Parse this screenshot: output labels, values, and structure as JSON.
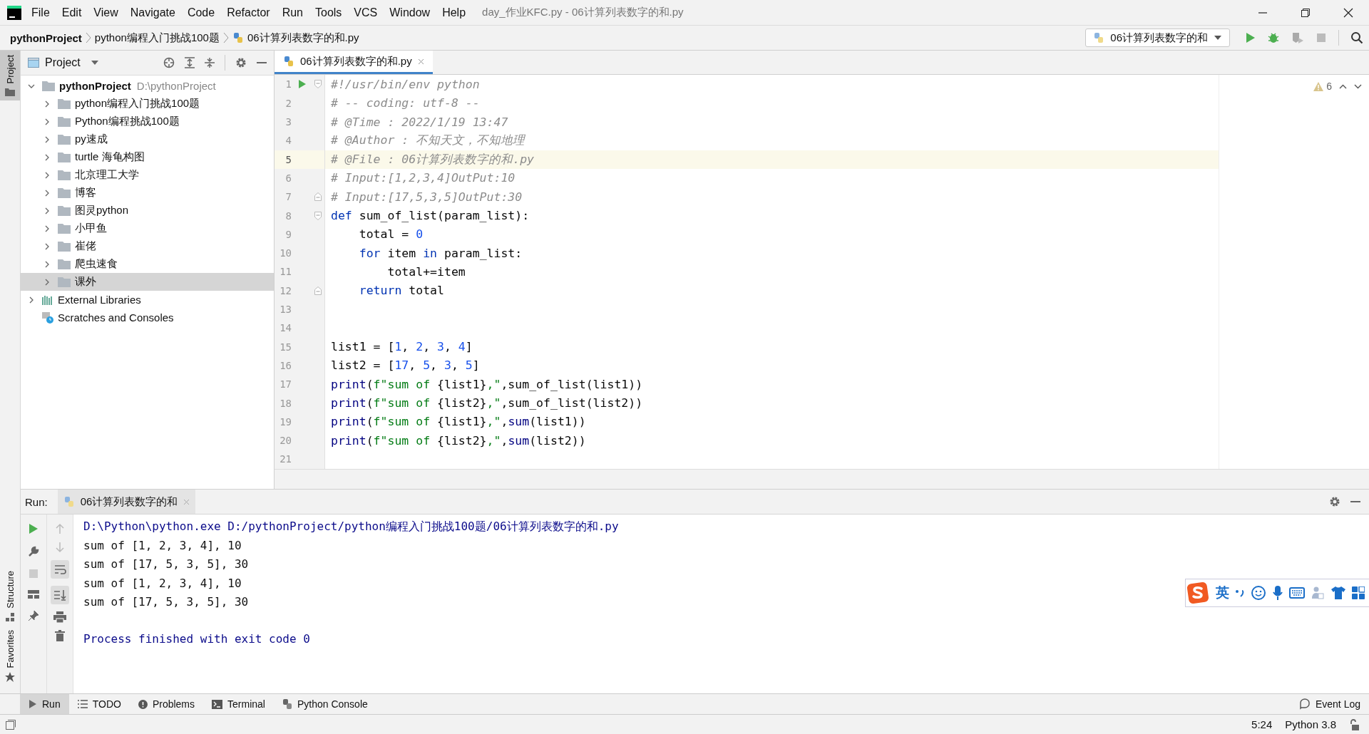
{
  "menu": [
    "File",
    "Edit",
    "View",
    "Navigate",
    "Code",
    "Refactor",
    "Run",
    "Tools",
    "VCS",
    "Window",
    "Help"
  ],
  "window": {
    "title": "day_作业KFC.py - 06计算列表数字的和.py"
  },
  "breadcrumbs": [
    "pythonProject",
    "python编程入门挑战100题",
    "06计算列表数字的和.py"
  ],
  "run_config": "06计算列表数字的和",
  "side_stripe": {
    "top": [
      {
        "label": "Project",
        "selected": true
      }
    ],
    "bottom": [
      {
        "label": "Structure",
        "selected": false
      },
      {
        "label": "Favorites",
        "selected": false
      }
    ]
  },
  "project_panel": {
    "title": "Project"
  },
  "tree": [
    {
      "label": "pythonProject",
      "path": "D:\\pythonProject",
      "kind": "project",
      "expanded": true,
      "selected": false,
      "children": [
        {
          "label": "python编程入门挑战100题",
          "kind": "folder",
          "expanded": false,
          "selected": false
        },
        {
          "label": "Python编程挑战100题",
          "kind": "folder",
          "expanded": false,
          "selected": false
        },
        {
          "label": "py速成",
          "kind": "folder",
          "expanded": false,
          "selected": false
        },
        {
          "label": "turtle 海龟构图",
          "kind": "folder",
          "expanded": false,
          "selected": false
        },
        {
          "label": "北京理工大学",
          "kind": "folder",
          "expanded": false,
          "selected": false
        },
        {
          "label": "博客",
          "kind": "folder",
          "expanded": false,
          "selected": false
        },
        {
          "label": "图灵python",
          "kind": "folder",
          "expanded": false,
          "selected": false
        },
        {
          "label": "小甲鱼",
          "kind": "folder",
          "expanded": false,
          "selected": false
        },
        {
          "label": "崔佬",
          "kind": "folder",
          "expanded": false,
          "selected": false
        },
        {
          "label": "爬虫速食",
          "kind": "folder",
          "expanded": false,
          "selected": false
        },
        {
          "label": "课外",
          "kind": "folder",
          "expanded": false,
          "selected": true
        }
      ]
    },
    {
      "label": "External Libraries",
      "kind": "library",
      "expanded": false,
      "selected": false
    },
    {
      "label": "Scratches and Consoles",
      "kind": "scratches",
      "selected": false
    }
  ],
  "editor_tabs": [
    {
      "label": "06计算列表数字的和.py",
      "selected": true
    }
  ],
  "warnings": "6",
  "code": [
    {
      "n": "1",
      "tokens": [
        {
          "text": "#!/usr/bin/env python",
          "kind": "comment"
        }
      ],
      "run": true,
      "fold_start": true
    },
    {
      "n": "2",
      "tokens": [
        {
          "text": "# -- coding: utf-8 --",
          "kind": "comment"
        }
      ]
    },
    {
      "n": "3",
      "tokens": [
        {
          "text": "# @Time : 2022/1/19 13:47",
          "kind": "comment"
        }
      ]
    },
    {
      "n": "4",
      "tokens": [
        {
          "text": "# @Author : 不知天文，不知地理",
          "kind": "comment"
        }
      ]
    },
    {
      "n": "5",
      "tokens": [
        {
          "text": "# @File : 06计算列表数字的和.py",
          "kind": "comment"
        }
      ],
      "current": true
    },
    {
      "n": "6",
      "tokens": [
        {
          "text": "# Input:[1,2,3,4]OutPut:10",
          "kind": "comment"
        }
      ]
    },
    {
      "n": "7",
      "tokens": [
        {
          "text": "# Input:[17,5,3,5]OutPut:30",
          "kind": "comment"
        }
      ],
      "fold_end": true
    },
    {
      "n": "8",
      "tokens": [
        {
          "text": "def",
          "kind": "keyword"
        },
        {
          "text": " sum_of_list(param_list):",
          "kind": "plain"
        }
      ],
      "fold_start": true
    },
    {
      "n": "9",
      "tokens": [
        {
          "text": "    total = ",
          "kind": "plain"
        },
        {
          "text": "0",
          "kind": "number"
        }
      ]
    },
    {
      "n": "10",
      "tokens": [
        {
          "text": "    for",
          "kind": "keyword"
        },
        {
          "text": " item ",
          "kind": "plain"
        },
        {
          "text": "in",
          "kind": "keyword"
        },
        {
          "text": " param_list:",
          "kind": "plain"
        }
      ]
    },
    {
      "n": "11",
      "tokens": [
        {
          "text": "        total+=item",
          "kind": "plain"
        }
      ]
    },
    {
      "n": "12",
      "tokens": [
        {
          "text": "    return",
          "kind": "keyword"
        },
        {
          "text": " total",
          "kind": "plain"
        }
      ],
      "fold_end": true
    },
    {
      "n": "13"
    },
    {
      "n": "14"
    },
    {
      "n": "15",
      "tokens": [
        {
          "text": "list1 = [",
          "kind": "plain"
        },
        {
          "text": "1",
          "kind": "number"
        },
        {
          "text": ", ",
          "kind": "plain"
        },
        {
          "text": "2",
          "kind": "number"
        },
        {
          "text": ", ",
          "kind": "plain"
        },
        {
          "text": "3",
          "kind": "number"
        },
        {
          "text": ", ",
          "kind": "plain"
        },
        {
          "text": "4",
          "kind": "number"
        },
        {
          "text": "]",
          "kind": "plain"
        }
      ]
    },
    {
      "n": "16",
      "tokens": [
        {
          "text": "list2 = [",
          "kind": "plain"
        },
        {
          "text": "17",
          "kind": "number"
        },
        {
          "text": ", ",
          "kind": "plain"
        },
        {
          "text": "5",
          "kind": "number"
        },
        {
          "text": ", ",
          "kind": "plain"
        },
        {
          "text": "3",
          "kind": "number"
        },
        {
          "text": ", ",
          "kind": "plain"
        },
        {
          "text": "5",
          "kind": "number"
        },
        {
          "text": "]",
          "kind": "plain"
        }
      ]
    },
    {
      "n": "17",
      "tokens": [
        {
          "text": "print",
          "kind": "builtin"
        },
        {
          "text": "(",
          "kind": "plain"
        },
        {
          "text": "f\"sum of ",
          "kind": "string"
        },
        {
          "text": "{list1}",
          "kind": "plain"
        },
        {
          "text": ",\"",
          "kind": "string"
        },
        {
          "text": ",sum_of_list(list1))",
          "kind": "plain"
        }
      ]
    },
    {
      "n": "18",
      "tokens": [
        {
          "text": "print",
          "kind": "builtin"
        },
        {
          "text": "(",
          "kind": "plain"
        },
        {
          "text": "f\"sum of ",
          "kind": "string"
        },
        {
          "text": "{list2}",
          "kind": "plain"
        },
        {
          "text": ",\"",
          "kind": "string"
        },
        {
          "text": ",sum_of_list(list2))",
          "kind": "plain"
        }
      ]
    },
    {
      "n": "19",
      "tokens": [
        {
          "text": "print",
          "kind": "builtin"
        },
        {
          "text": "(",
          "kind": "plain"
        },
        {
          "text": "f\"sum of ",
          "kind": "string"
        },
        {
          "text": "{list1}",
          "kind": "plain"
        },
        {
          "text": ",\"",
          "kind": "string"
        },
        {
          "text": ",",
          "kind": "plain"
        },
        {
          "text": "sum",
          "kind": "builtin"
        },
        {
          "text": "(list1))",
          "kind": "plain"
        }
      ]
    },
    {
      "n": "20",
      "tokens": [
        {
          "text": "print",
          "kind": "builtin"
        },
        {
          "text": "(",
          "kind": "plain"
        },
        {
          "text": "f\"sum of ",
          "kind": "string"
        },
        {
          "text": "{list2}",
          "kind": "plain"
        },
        {
          "text": ",\"",
          "kind": "string"
        },
        {
          "text": ",",
          "kind": "plain"
        },
        {
          "text": "sum",
          "kind": "builtin"
        },
        {
          "text": "(list2))",
          "kind": "plain"
        }
      ]
    },
    {
      "n": "21"
    }
  ],
  "run_panel": {
    "label": "Run:",
    "tabs": [
      {
        "label": "06计算列表数字的和",
        "selected": true
      }
    ],
    "output": [
      {
        "text": "D:\\Python\\python.exe D:/pythonProject/python编程入门挑战100题/06计算列表数字的和.py",
        "kind": "system"
      },
      {
        "text": "sum of [1, 2, 3, 4], 10",
        "kind": "stdout"
      },
      {
        "text": "sum of [17, 5, 3, 5], 30",
        "kind": "stdout"
      },
      {
        "text": "sum of [1, 2, 3, 4], 10",
        "kind": "stdout"
      },
      {
        "text": "sum of [17, 5, 3, 5], 30",
        "kind": "stdout"
      },
      {
        "kind": "blank"
      },
      {
        "text": "Process finished with exit code 0",
        "kind": "system"
      }
    ]
  },
  "ime_toolbar": {
    "mode": "英"
  },
  "tool_tabs": [
    {
      "label": "Run",
      "kind": "run",
      "selected": true
    },
    {
      "label": "TODO",
      "kind": "todo",
      "selected": false
    },
    {
      "label": "Problems",
      "kind": "problems",
      "selected": false
    },
    {
      "label": "Terminal",
      "kind": "terminal",
      "selected": false
    },
    {
      "label": "Python Console",
      "kind": "console",
      "selected": false
    }
  ],
  "event_log": "Event Log",
  "status_bar": {
    "position": "5:24",
    "interpreter": "Python 3.8"
  }
}
